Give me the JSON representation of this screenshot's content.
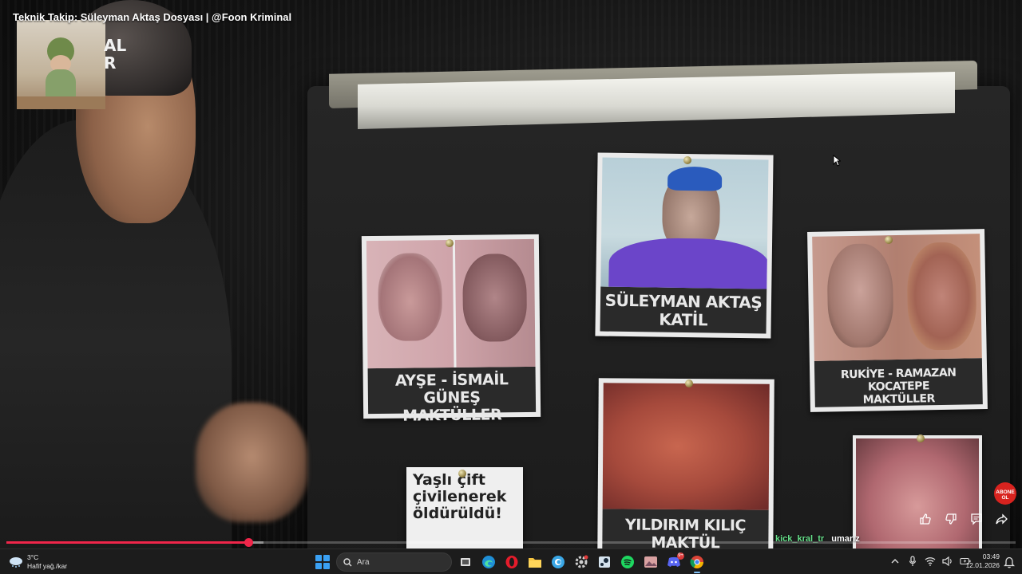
{
  "video": {
    "title": "Teknik Takip: Süleyman Aktaş Dosyası | @Foon Kriminal",
    "channel_mark_lines": [
      "AL",
      "R"
    ],
    "board_cards": {
      "victims_left": {
        "caption": "AYŞE - İSMAİL GÜNEŞ\nMAKTÜLLER"
      },
      "killer": {
        "caption": "SÜLEYMAN AKTAŞ\nKATİL"
      },
      "victims_right": {
        "caption": "RUKİYE - RAMAZAN KOCATEPE\nMAKTÜLLER"
      },
      "newspaper": {
        "headline": "Yaşlı çift\nçivilenerek\nöldürüldü!"
      },
      "bottom_center": {
        "caption": "YILDIRIM KILIÇ\nMAKTÜL"
      }
    },
    "progress_fraction": 0.24,
    "buffered_fraction": 0.255
  },
  "overlay": {
    "chat": {
      "username": "kick_kral_tr",
      "message": "umarız"
    },
    "subscribe_badge": "ABONE\nOL",
    "actions": [
      {
        "name": "like-button",
        "icon": "thumbs-up-icon"
      },
      {
        "name": "dislike-button",
        "icon": "thumbs-down-icon"
      },
      {
        "name": "comments-button",
        "icon": "comment-icon"
      },
      {
        "name": "share-button",
        "icon": "share-icon"
      }
    ]
  },
  "taskbar": {
    "weather": {
      "temp": "3°C",
      "desc": "Hafif yağ./kar"
    },
    "search": {
      "placeholder": "Ara"
    },
    "apps": [
      "task-view",
      "edge",
      "opera",
      "file-explorer",
      "copilot",
      "settings",
      "steam",
      "spotify",
      "photos",
      "discord",
      "chrome"
    ],
    "discord_badge": "9+",
    "clock": {
      "time": "03:49",
      "date": "12.01.2026"
    }
  },
  "colors": {
    "accent_progress": "#f0264a",
    "chat_user": "#66e08a",
    "taskbar_bg": "#1c1c1c",
    "windows_blue": "#3aa0f3"
  }
}
